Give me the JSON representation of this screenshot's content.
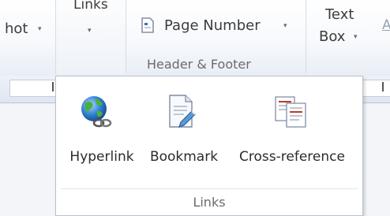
{
  "ribbon": {
    "screenshot_label": "hot",
    "links_label": "Links",
    "page_number_label": "Page Number",
    "header_footer_group": "Header & Footer",
    "text_label": "Text",
    "box_label": "Box",
    "dropdown_arrow": "▾",
    "cut_symbol": "A"
  },
  "links_menu": {
    "items": [
      {
        "label": "Hyperlink",
        "icon": "globe-chain-icon"
      },
      {
        "label": "Bookmark",
        "icon": "bookmark-page-icon"
      },
      {
        "label": "Cross-reference",
        "icon": "cross-reference-icon"
      }
    ],
    "group_label": "Links"
  }
}
